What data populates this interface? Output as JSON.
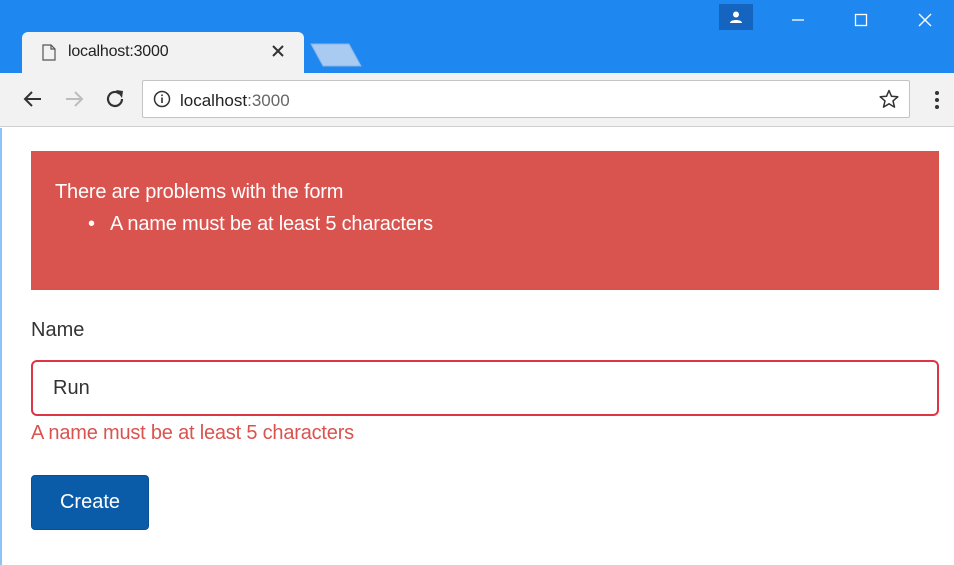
{
  "browser": {
    "tab_title": "localhost:3000",
    "url_host": "localhost",
    "url_port": ":3000",
    "colors": {
      "frame": "#1e88f0",
      "toolbar": "#f2f2f2"
    },
    "icons": [
      "page-icon",
      "close-icon",
      "profile-icon",
      "minimize-icon",
      "maximize-icon",
      "close-window-icon",
      "back-arrow-icon",
      "forward-arrow-icon",
      "reload-icon",
      "info-icon",
      "star-icon",
      "menu-icon"
    ]
  },
  "alert": {
    "title": "There are problems with the form",
    "items": [
      {
        "bullet": "•",
        "text": "A name must be at least 5 characters"
      }
    ],
    "color": "#d9534f"
  },
  "form": {
    "name_label": "Name",
    "name_value": "Run",
    "name_error": "A name must be at least 5 characters",
    "error_color": "#dc3545"
  },
  "actions": {
    "create_label": "Create",
    "color": "#0b5ca8"
  }
}
